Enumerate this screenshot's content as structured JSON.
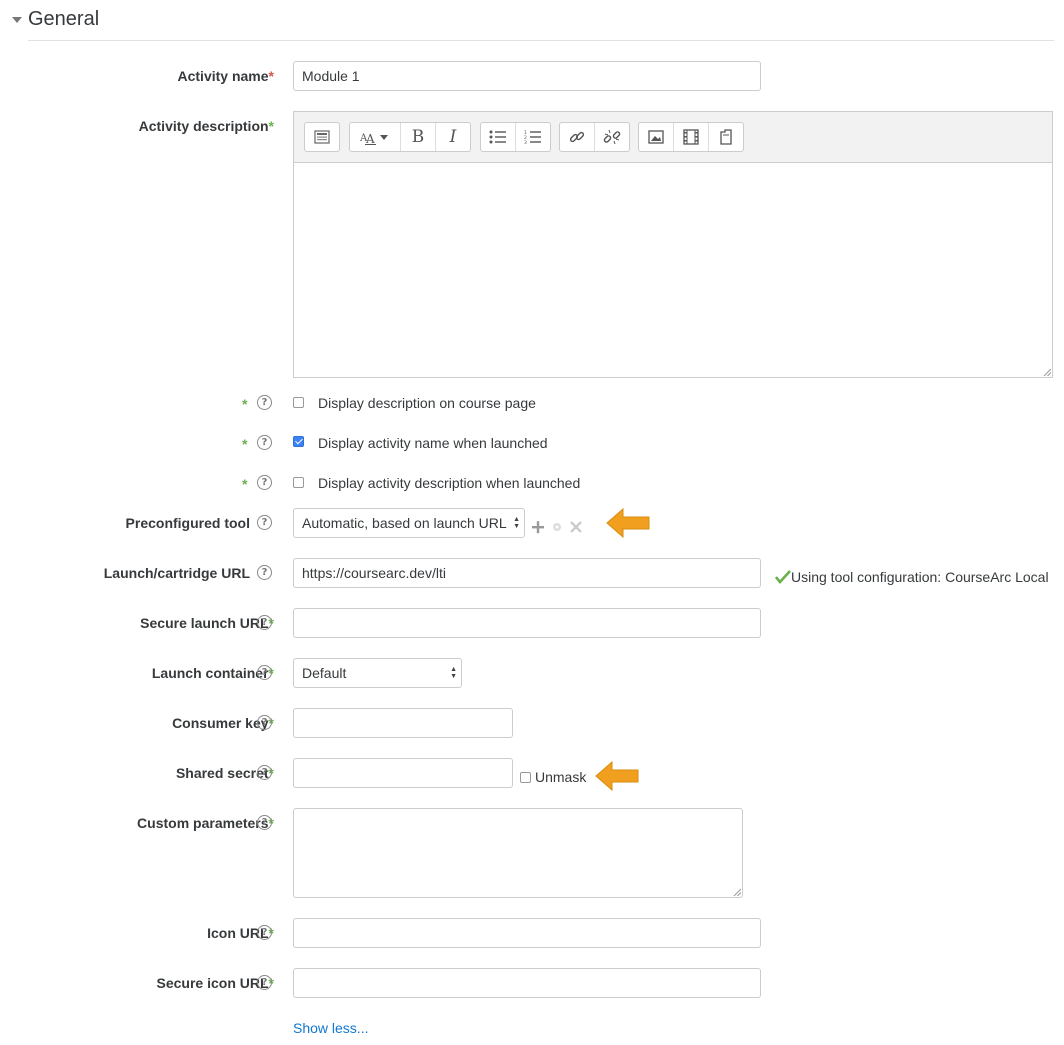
{
  "section": {
    "title": "General"
  },
  "fields": {
    "activity_name": {
      "label": "Activity name",
      "required_mark": "*",
      "value": "Module 1"
    },
    "activity_description": {
      "label": "Activity description",
      "advanced_mark": "*"
    },
    "display_description": {
      "label": "Display description on course page",
      "checked": false
    },
    "display_name_launched": {
      "label": "Display activity name when launched",
      "checked": true
    },
    "display_desc_launched": {
      "label": "Display activity description when launched",
      "checked": false
    },
    "preconfigured_tool": {
      "label": "Preconfigured tool",
      "value": "Automatic, based on launch URL"
    },
    "launch_url": {
      "label": "Launch/cartridge URL",
      "value": "https://coursearc.dev/lti",
      "status": "Using tool configuration: CourseArc Local"
    },
    "secure_launch_url": {
      "label": "Secure launch URL",
      "advanced_mark": "*",
      "value": ""
    },
    "launch_container": {
      "label": "Launch container",
      "advanced_mark": "*",
      "value": "Default"
    },
    "consumer_key": {
      "label": "Consumer key",
      "advanced_mark": "*",
      "value": ""
    },
    "shared_secret": {
      "label": "Shared secret",
      "advanced_mark": "*",
      "value": "",
      "unmask_label": "Unmask"
    },
    "custom_parameters": {
      "label": "Custom parameters",
      "advanced_mark": "*"
    },
    "icon_url": {
      "label": "Icon URL",
      "advanced_mark": "*",
      "value": ""
    },
    "secure_icon_url": {
      "label": "Secure icon URL",
      "advanced_mark": "*",
      "value": ""
    }
  },
  "help_glyph": "?",
  "adv_star": "*",
  "show_less": "Show less...",
  "colors": {
    "required": "#d9534f",
    "advanced": "#6ab04c",
    "arrow": "#f0a01e",
    "link": "#1177d1",
    "check_blue": "#3b82f6"
  }
}
